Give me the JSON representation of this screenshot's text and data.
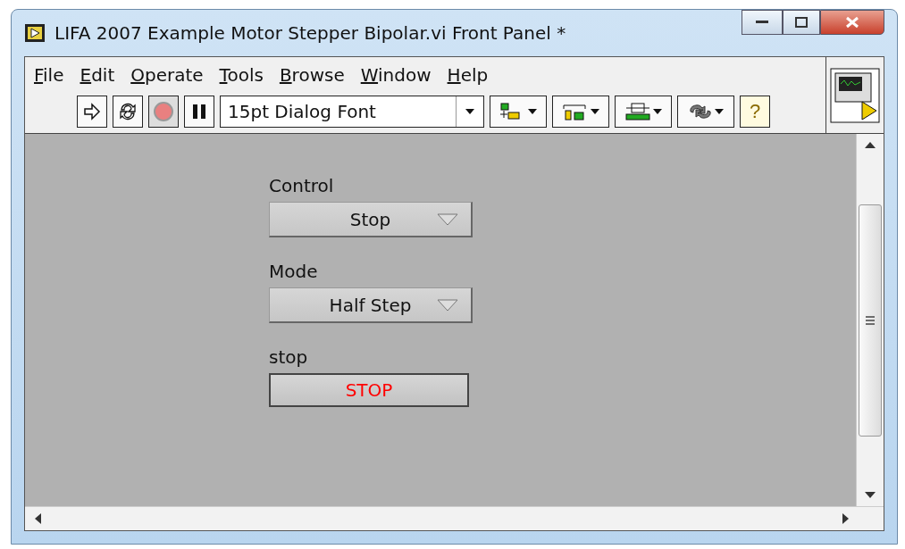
{
  "window": {
    "title": "LIFA 2007 Example Motor Stepper Bipolar.vi Front Panel *"
  },
  "menu": [
    "File",
    "Edit",
    "Operate",
    "Tools",
    "Browse",
    "Window",
    "Help"
  ],
  "toolbar": {
    "font": "15pt Dialog Font",
    "help": "?"
  },
  "controls": [
    {
      "kind": "ring",
      "label": "Control",
      "value": "Stop"
    },
    {
      "kind": "ring",
      "label": "Mode",
      "value": "Half Step"
    },
    {
      "kind": "button",
      "label": "stop",
      "value": "STOP"
    }
  ]
}
